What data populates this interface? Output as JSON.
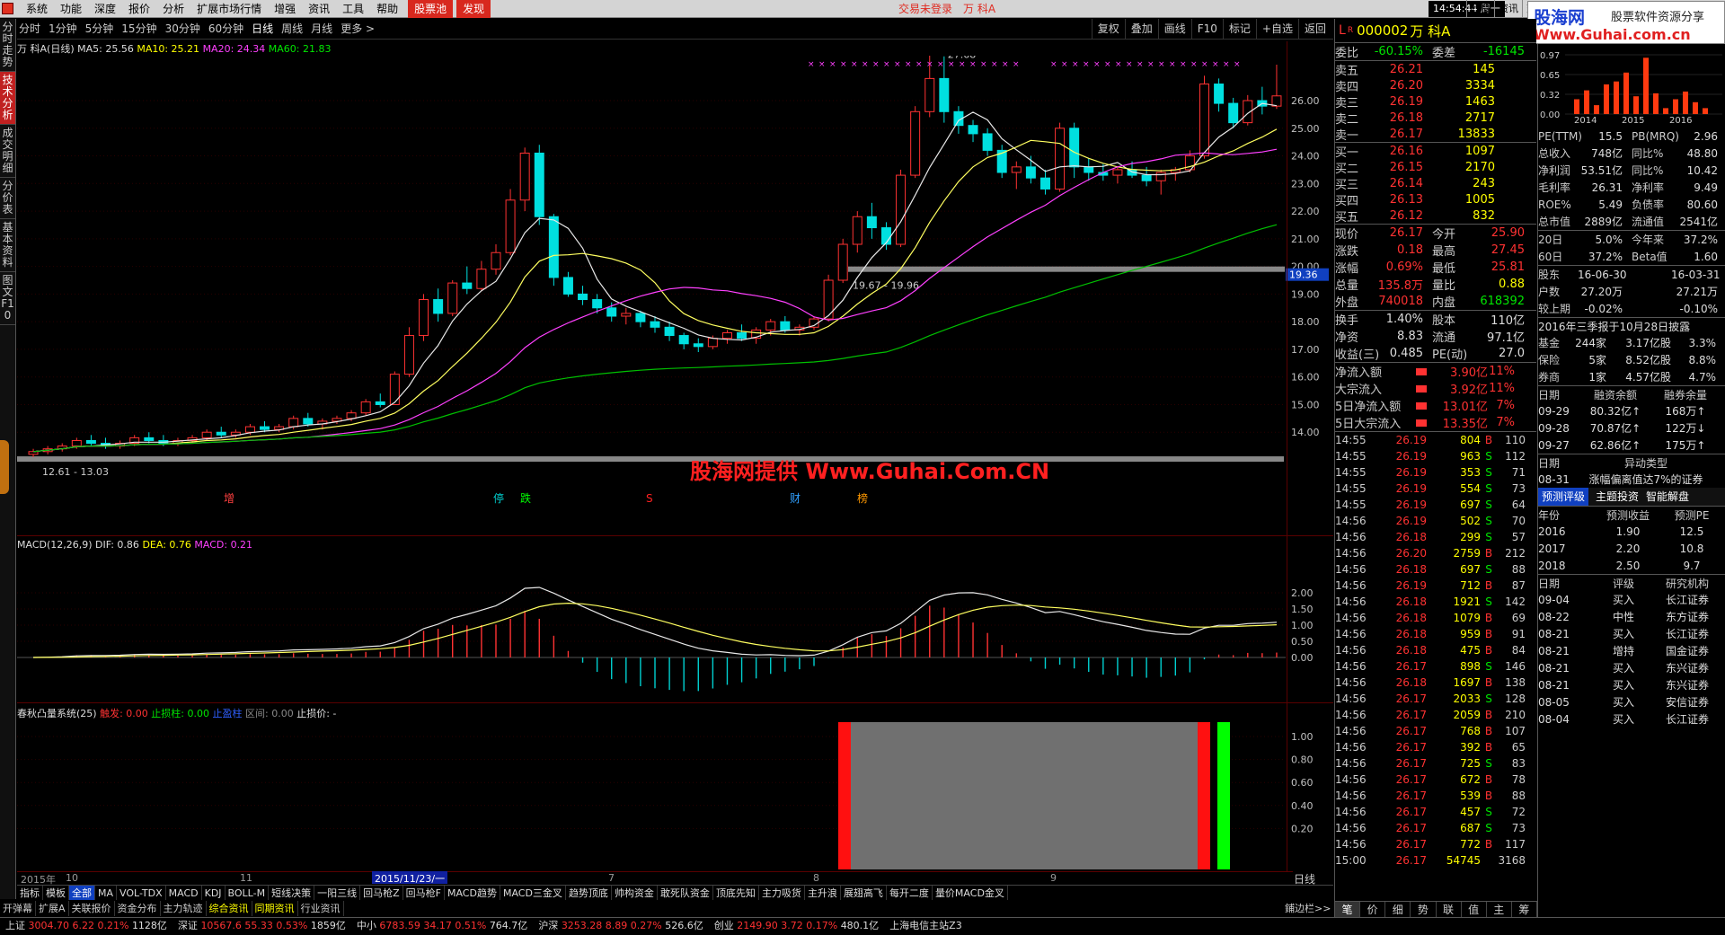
{
  "menu": {
    "items": [
      "系统",
      "功能",
      "深度",
      "报价",
      "分析",
      "扩展市场行情",
      "增强",
      "资讯",
      "工具",
      "帮助"
    ],
    "pool": "股票池",
    "discover": "发现",
    "trade_status": "交易未登录",
    "stock_short": "万 科A",
    "clock": "14:54:44 周一",
    "top_btns": [
      "行情",
      "资讯",
      "交易"
    ]
  },
  "sitelogo": {
    "name": "股海网",
    "tagline": "股票软件资源分享",
    "url": "Www.Guhai.com.cn"
  },
  "left_tabs": [
    "分时走势",
    "技术分析",
    "成交明细",
    "分价表",
    "基本资料",
    "图文F10"
  ],
  "periods": {
    "items": [
      "分时",
      "1分钟",
      "5分钟",
      "15分钟",
      "30分钟",
      "60分钟",
      "日线",
      "周线",
      "月线",
      "更多 >"
    ],
    "selected": "日线"
  },
  "toolbar": [
    "复权",
    "叠加",
    "画线",
    "F10",
    "标记",
    "+自选",
    "返回"
  ],
  "chart_header": {
    "name": "万 科A",
    "period": "(日线)",
    "ma5": "MA5: 25.56",
    "ma10": "MA10: 25.21",
    "ma20": "MA20: 24.34",
    "ma60": "MA60: 21.83"
  },
  "chart_data": {
    "type": "candlestick",
    "y_ticks": [
      "26.00",
      "25.00",
      "24.00",
      "23.00",
      "22.00",
      "21.00",
      "20.00",
      "19.00",
      "18.00",
      "17.00",
      "16.00",
      "15.00",
      "14.00"
    ],
    "ylim": [
      13.0,
      27.3
    ],
    "candles": [
      [
        13.2,
        13.4,
        13.1,
        13.3
      ],
      [
        13.3,
        13.5,
        13.2,
        13.4
      ],
      [
        13.4,
        13.6,
        13.3,
        13.5
      ],
      [
        13.5,
        13.8,
        13.4,
        13.7
      ],
      [
        13.7,
        13.9,
        13.5,
        13.6
      ],
      [
        13.6,
        13.8,
        13.4,
        13.5
      ],
      [
        13.5,
        13.7,
        13.4,
        13.6
      ],
      [
        13.6,
        13.9,
        13.5,
        13.8
      ],
      [
        13.8,
        14.0,
        13.6,
        13.7
      ],
      [
        13.7,
        13.9,
        13.5,
        13.6
      ],
      [
        13.6,
        13.8,
        13.5,
        13.7
      ],
      [
        13.7,
        13.9,
        13.6,
        13.8
      ],
      [
        13.8,
        14.1,
        13.7,
        14.0
      ],
      [
        14.0,
        14.2,
        13.8,
        13.9
      ],
      [
        13.9,
        14.1,
        13.8,
        14.0
      ],
      [
        14.0,
        14.3,
        13.9,
        14.2
      ],
      [
        14.2,
        14.4,
        14.0,
        14.1
      ],
      [
        14.1,
        14.3,
        14.0,
        14.2
      ],
      [
        14.2,
        14.6,
        14.1,
        14.5
      ],
      [
        14.5,
        14.7,
        14.2,
        14.3
      ],
      [
        14.3,
        14.5,
        14.1,
        14.4
      ],
      [
        14.4,
        14.6,
        14.3,
        14.5
      ],
      [
        14.5,
        14.8,
        14.4,
        14.7
      ],
      [
        14.7,
        15.2,
        14.6,
        15.1
      ],
      [
        15.1,
        15.4,
        14.9,
        15.0
      ],
      [
        15.0,
        16.2,
        15.0,
        16.1
      ],
      [
        16.1,
        17.8,
        16.0,
        17.5
      ],
      [
        17.5,
        19.0,
        17.3,
        18.8
      ],
      [
        18.8,
        19.2,
        18.0,
        18.3
      ],
      [
        18.3,
        19.5,
        18.2,
        19.4
      ],
      [
        19.4,
        20.0,
        19.0,
        19.2
      ],
      [
        19.2,
        20.2,
        19.1,
        19.9
      ],
      [
        19.9,
        20.8,
        19.7,
        20.5
      ],
      [
        20.5,
        22.8,
        20.4,
        22.4
      ],
      [
        22.4,
        24.3,
        22.0,
        24.1
      ],
      [
        24.1,
        24.4,
        21.5,
        21.8
      ],
      [
        21.8,
        21.9,
        19.3,
        19.6
      ],
      [
        19.6,
        19.8,
        18.9,
        19.0
      ],
      [
        19.0,
        19.3,
        18.6,
        18.8
      ],
      [
        18.8,
        19.0,
        18.3,
        18.5
      ],
      [
        18.5,
        18.7,
        18.0,
        18.2
      ],
      [
        18.2,
        18.5,
        17.9,
        18.3
      ],
      [
        18.3,
        18.4,
        17.8,
        18.0
      ],
      [
        18.0,
        18.2,
        17.6,
        17.8
      ],
      [
        17.8,
        18.0,
        17.3,
        17.5
      ],
      [
        17.5,
        17.6,
        17.0,
        17.2
      ],
      [
        17.2,
        17.4,
        16.9,
        17.1
      ],
      [
        17.1,
        17.5,
        17.0,
        17.4
      ],
      [
        17.4,
        17.7,
        17.2,
        17.6
      ],
      [
        17.6,
        17.9,
        17.3,
        17.4
      ],
      [
        17.4,
        17.8,
        17.2,
        17.7
      ],
      [
        17.7,
        18.1,
        17.5,
        18.0
      ],
      [
        18.0,
        18.2,
        17.6,
        17.7
      ],
      [
        17.7,
        17.9,
        17.5,
        17.8
      ],
      [
        17.8,
        18.2,
        17.7,
        18.1
      ],
      [
        18.1,
        19.7,
        18.0,
        19.5
      ],
      [
        19.5,
        21.0,
        19.4,
        20.8
      ],
      [
        20.8,
        22.0,
        20.5,
        21.8
      ],
      [
        21.8,
        22.3,
        21.0,
        21.4
      ],
      [
        21.4,
        21.6,
        20.6,
        20.8
      ],
      [
        20.8,
        23.5,
        20.7,
        23.3
      ],
      [
        23.3,
        25.8,
        23.2,
        25.6
      ],
      [
        25.6,
        27.7,
        25.4,
        26.8
      ],
      [
        26.8,
        27.6,
        25.2,
        25.6
      ],
      [
        25.6,
        25.8,
        24.8,
        25.1
      ],
      [
        25.1,
        25.3,
        24.5,
        24.8
      ],
      [
        24.8,
        25.0,
        24.0,
        24.2
      ],
      [
        24.2,
        24.4,
        23.2,
        23.4
      ],
      [
        23.4,
        23.8,
        22.8,
        23.6
      ],
      [
        23.6,
        24.0,
        23.0,
        23.2
      ],
      [
        23.2,
        23.5,
        22.6,
        22.8
      ],
      [
        22.8,
        25.2,
        22.7,
        25.0
      ],
      [
        25.0,
        25.2,
        23.2,
        23.6
      ],
      [
        23.6,
        23.9,
        23.1,
        23.4
      ],
      [
        23.4,
        23.7,
        23.1,
        23.3
      ],
      [
        23.3,
        23.6,
        23.0,
        23.5
      ],
      [
        23.5,
        23.8,
        23.2,
        23.3
      ],
      [
        23.3,
        23.6,
        22.9,
        23.1
      ],
      [
        23.1,
        23.5,
        22.6,
        23.4
      ],
      [
        23.4,
        23.6,
        23.1,
        23.5
      ],
      [
        23.5,
        24.2,
        23.4,
        24.0
      ],
      [
        24.0,
        26.9,
        23.9,
        26.6
      ],
      [
        26.6,
        26.8,
        25.6,
        25.9
      ],
      [
        25.9,
        26.1,
        25.0,
        25.2
      ],
      [
        25.2,
        26.2,
        25.1,
        26.0
      ],
      [
        26.0,
        26.5,
        25.5,
        25.8
      ],
      [
        25.8,
        27.3,
        25.7,
        26.17
      ]
    ],
    "last_price_tag": "19.36",
    "high_label": "27.68",
    "low_label": "12.61 - 13.03",
    "gap_label": "19.67 - 19.96",
    "events": [
      {
        "text": "增",
        "color": "#ff4040"
      },
      {
        "text": "停",
        "color": "#00d0d0"
      },
      {
        "text": "跌",
        "color": "#00ff00"
      },
      {
        "text": "S",
        "color": "#ff2020"
      },
      {
        "text": "财",
        "color": "#30a0ff"
      },
      {
        "text": "榜",
        "color": "#ff9900"
      }
    ]
  },
  "macd": {
    "header": "MACD(12,26,9)",
    "dif": "DIF: 0.86",
    "dea": "DEA: 0.76",
    "macd": "MACD: 0.21",
    "y_ticks": [
      "2.00",
      "1.50",
      "1.00",
      "0.50",
      "0.00"
    ]
  },
  "sys": {
    "header": "春秋凸量系统(25)",
    "touch": "触发: 0.00",
    "stop": "止损柱: 0.00",
    "stop2": "止盈柱",
    "zone": "区间: 0.00",
    "stopprice": "止损价: -",
    "y_ticks": [
      "1.00",
      "0.80",
      "0.60",
      "0.40",
      "0.20"
    ]
  },
  "dates": {
    "year": "2015年",
    "m10": "10",
    "m11": "11",
    "sel": "2015/11/23/一",
    "m2": "2",
    "m7": "7",
    "m8": "8",
    "m9": "9",
    "axis": "日线"
  },
  "formula_tabs": [
    "指标",
    "模板",
    "全部",
    "MA",
    "VOL-TDX",
    "MACD",
    "KDJ",
    "BOLL-M",
    "短线决策",
    "一阳三线",
    "回马枪Z",
    "回马枪F",
    "MACD趋势",
    "MACD三金叉",
    "趋势顶底",
    "帅构资金",
    "敢死队资金",
    "顶底先知",
    "主力吸货",
    "主升浪",
    "展翅高飞",
    "每开二度",
    "量价MACD金叉"
  ],
  "func_tabs": [
    "开弹幕",
    "扩展A",
    "关联报价",
    "资金分布",
    "主力轨迹",
    "综合资讯",
    "同期资讯",
    "行业资讯"
  ],
  "func_right": "鋪边栏>>",
  "index_bar": [
    {
      "name": "上证",
      "val": "3004.70",
      "chg": "6.22",
      "pct": "0.21%",
      "amt": "1128亿"
    },
    {
      "name": "深证",
      "val": "10567.6",
      "chg": "55.33",
      "pct": "0.53%",
      "amt": "1859亿"
    },
    {
      "name": "中小",
      "val": "6783.59",
      "chg": "34.17",
      "pct": "0.51%",
      "amt": "764.7亿"
    },
    {
      "name": "沪深",
      "val": "3253.28",
      "chg": "8.89",
      "pct": "0.27%",
      "amt": "526.6亿"
    },
    {
      "name": "创业",
      "val": "2149.90",
      "chg": "3.72",
      "pct": "0.17%",
      "amt": "480.1亿"
    }
  ],
  "index_right": "上海电信主站Z3",
  "quote": {
    "code": "000002",
    "name": "万 科A",
    "flag": "L",
    "sub": "R",
    "weibi": "委比",
    "weibi_v": "-60.15%",
    "weicha": "委差",
    "weicha_v": "-16145",
    "sell": [
      [
        "卖五",
        "26.21",
        "145"
      ],
      [
        "卖四",
        "26.20",
        "3334"
      ],
      [
        "卖三",
        "26.19",
        "1463"
      ],
      [
        "卖二",
        "26.18",
        "2717"
      ],
      [
        "卖一",
        "26.17",
        "13833"
      ]
    ],
    "buy": [
      [
        "买一",
        "26.16",
        "1097"
      ],
      [
        "买二",
        "26.15",
        "2170"
      ],
      [
        "买三",
        "26.14",
        "243"
      ],
      [
        "买四",
        "26.13",
        "1005"
      ],
      [
        "买五",
        "26.12",
        "832"
      ]
    ],
    "stats": [
      [
        "现价",
        "26.17",
        "今开",
        "25.90"
      ],
      [
        "涨跌",
        "0.18",
        "最高",
        "27.45"
      ],
      [
        "涨幅",
        "0.69%",
        "最低",
        "25.81"
      ],
      [
        "总量",
        "135.8万",
        "量比",
        "0.88"
      ],
      [
        "外盘",
        "740018",
        "内盘",
        "618392"
      ]
    ],
    "stats2": [
      [
        "换手",
        "1.40%",
        "股本",
        "110亿"
      ],
      [
        "净资",
        "8.83",
        "流通",
        "97.1亿"
      ],
      [
        "收益(三)",
        "0.485",
        "PE(动)",
        "27.0"
      ]
    ],
    "flows": [
      [
        "净流入额",
        "3.90亿",
        "11%"
      ],
      [
        "大宗流入",
        "3.92亿",
        "11%"
      ],
      [
        "5日净流入额",
        "13.01亿",
        "7%"
      ],
      [
        "5日大宗流入",
        "13.35亿",
        "7%"
      ]
    ],
    "ticks": [
      [
        "14:55",
        "26.19",
        "804",
        "B",
        "110"
      ],
      [
        "14:55",
        "26.19",
        "963",
        "S",
        "112"
      ],
      [
        "14:55",
        "26.19",
        "353",
        "S",
        "71"
      ],
      [
        "14:55",
        "26.19",
        "554",
        "S",
        "73"
      ],
      [
        "14:55",
        "26.19",
        "697",
        "S",
        "64"
      ],
      [
        "14:56",
        "26.19",
        "502",
        "S",
        "70"
      ],
      [
        "14:56",
        "26.18",
        "299",
        "S",
        "57"
      ],
      [
        "14:56",
        "26.20",
        "2759",
        "B",
        "212"
      ],
      [
        "14:56",
        "26.18",
        "697",
        "S",
        "88"
      ],
      [
        "14:56",
        "26.19",
        "712",
        "B",
        "87"
      ],
      [
        "14:56",
        "26.18",
        "1921",
        "S",
        "142"
      ],
      [
        "14:56",
        "26.18",
        "1079",
        "B",
        "69"
      ],
      [
        "14:56",
        "26.18",
        "959",
        "B",
        "91"
      ],
      [
        "14:56",
        "26.18",
        "475",
        "B",
        "84"
      ],
      [
        "14:56",
        "26.17",
        "898",
        "S",
        "146"
      ],
      [
        "14:56",
        "26.18",
        "1697",
        "B",
        "138"
      ],
      [
        "14:56",
        "26.17",
        "2033",
        "S",
        "128"
      ],
      [
        "14:56",
        "26.17",
        "2059",
        "B",
        "210"
      ],
      [
        "14:56",
        "26.17",
        "768",
        "B",
        "107"
      ],
      [
        "14:56",
        "26.17",
        "392",
        "B",
        "65"
      ],
      [
        "14:56",
        "26.17",
        "725",
        "S",
        "83"
      ],
      [
        "14:56",
        "26.17",
        "672",
        "B",
        "78"
      ],
      [
        "14:56",
        "26.17",
        "539",
        "B",
        "88"
      ],
      [
        "14:56",
        "26.17",
        "457",
        "S",
        "72"
      ],
      [
        "14:56",
        "26.17",
        "687",
        "S",
        "73"
      ],
      [
        "14:56",
        "26.17",
        "772",
        "B",
        "117"
      ],
      [
        "15:00",
        "26.17",
        "54745",
        "",
        "3168"
      ]
    ],
    "tick_tabs": [
      "笔",
      "价",
      "细",
      "势",
      "联",
      "值",
      "主",
      "筹"
    ]
  },
  "fund": {
    "mini_years": [
      "2014",
      "2015",
      "2016"
    ],
    "mini_ticks": [
      "0.97",
      "0.65",
      "0.32",
      "0.00"
    ],
    "rows": [
      [
        "PE(TTM)",
        "15.5",
        "PB(MRQ)",
        "2.96"
      ],
      [
        "总收入",
        "748亿",
        "同比%",
        "48.80"
      ],
      [
        "净利润",
        "53.51亿",
        "同比%",
        "10.42"
      ],
      [
        "毛利率",
        "26.31",
        "净利率",
        "9.49"
      ],
      [
        "ROE%",
        "5.49",
        "负债率",
        "80.60"
      ],
      [
        "总市值",
        "2889亿",
        "流通值",
        "2541亿"
      ]
    ],
    "rows2": [
      [
        "20日",
        "5.0%",
        "今年来",
        "37.2%"
      ],
      [
        "60日",
        "37.2%",
        "Beta值",
        "1.60"
      ]
    ],
    "rows3": [
      [
        "股东",
        "16-06-30",
        "",
        "16-03-31"
      ],
      [
        "户数",
        "27.20万",
        "",
        "27.21万"
      ],
      [
        "较上期",
        "-0.02%",
        "",
        "-0.10%"
      ]
    ],
    "report": "2016年三季报于10月28日披露",
    "inst": [
      [
        "基金",
        "244家",
        "3.17亿股",
        "3.3%"
      ],
      [
        "保险",
        "5家",
        "8.52亿股",
        "8.8%"
      ],
      [
        "券商",
        "1家",
        "4.57亿股",
        "4.7%"
      ]
    ],
    "margin_hdr": [
      "日期",
      "融资余额",
      "融券余量"
    ],
    "margin": [
      [
        "09-29",
        "80.32亿↑",
        "168万↑"
      ],
      [
        "09-28",
        "70.87亿↑",
        "122万↓"
      ],
      [
        "09-27",
        "62.86亿↑",
        "175万↑"
      ]
    ],
    "unusual_hdr": [
      "日期",
      "异动类型"
    ],
    "unusual": [
      [
        "08-31",
        "涨幅偏离值达7%的证券"
      ]
    ],
    "tabs": [
      "预测评级",
      "主题投资",
      "智能解盘"
    ],
    "fc_hdr": [
      "年份",
      "预测收益",
      "预测PE"
    ],
    "forecast": [
      [
        "2016",
        "1.90",
        "12.5"
      ],
      [
        "2017",
        "2.20",
        "10.8"
      ],
      [
        "2018",
        "2.50",
        "9.7"
      ]
    ],
    "rt_hdr": [
      "日期",
      "评级",
      "研究机构"
    ],
    "ratings": [
      [
        "09-04",
        "买入",
        "长江证券"
      ],
      [
        "08-22",
        "中性",
        "东方证券"
      ],
      [
        "08-21",
        "买入",
        "长江证券"
      ],
      [
        "08-21",
        "增持",
        "国金证券"
      ],
      [
        "08-21",
        "买入",
        "东兴证券"
      ],
      [
        "08-21",
        "买入",
        "东兴证券"
      ],
      [
        "08-05",
        "买入",
        "安信证券"
      ],
      [
        "08-04",
        "买入",
        "长江证券"
      ]
    ]
  },
  "watermark": "股海网提供 Www.Guhai.Com.CN"
}
